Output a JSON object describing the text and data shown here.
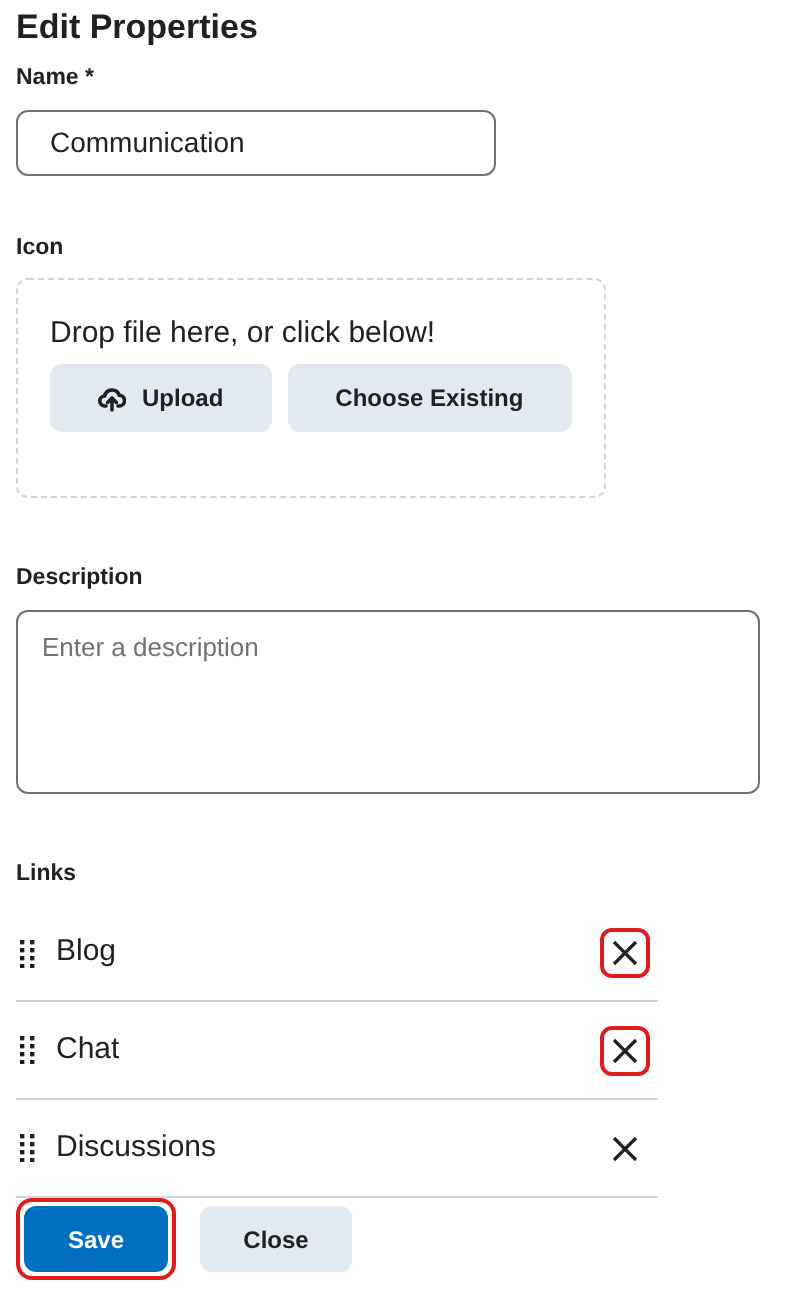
{
  "title": "Edit Properties",
  "name_field": {
    "label": "Name *",
    "value": "Communication"
  },
  "icon_field": {
    "label": "Icon",
    "drop_text": "Drop file here, or click below!",
    "buttons": [
      {
        "label": "Upload",
        "kind": "upload"
      },
      {
        "label": "Choose Existing",
        "kind": "plain"
      }
    ]
  },
  "description_field": {
    "label": "Description",
    "placeholder": "Enter a description"
  },
  "links": {
    "label": "Links",
    "items": [
      {
        "label": "Blog",
        "highlighted": true
      },
      {
        "label": "Chat",
        "highlighted": true
      },
      {
        "label": "Discussions",
        "highlighted": false
      }
    ]
  },
  "footer_buttons": [
    {
      "label": "Save",
      "kind": "primary",
      "highlighted": true
    },
    {
      "label": "Close",
      "kind": "secondary",
      "highlighted": false
    }
  ]
}
